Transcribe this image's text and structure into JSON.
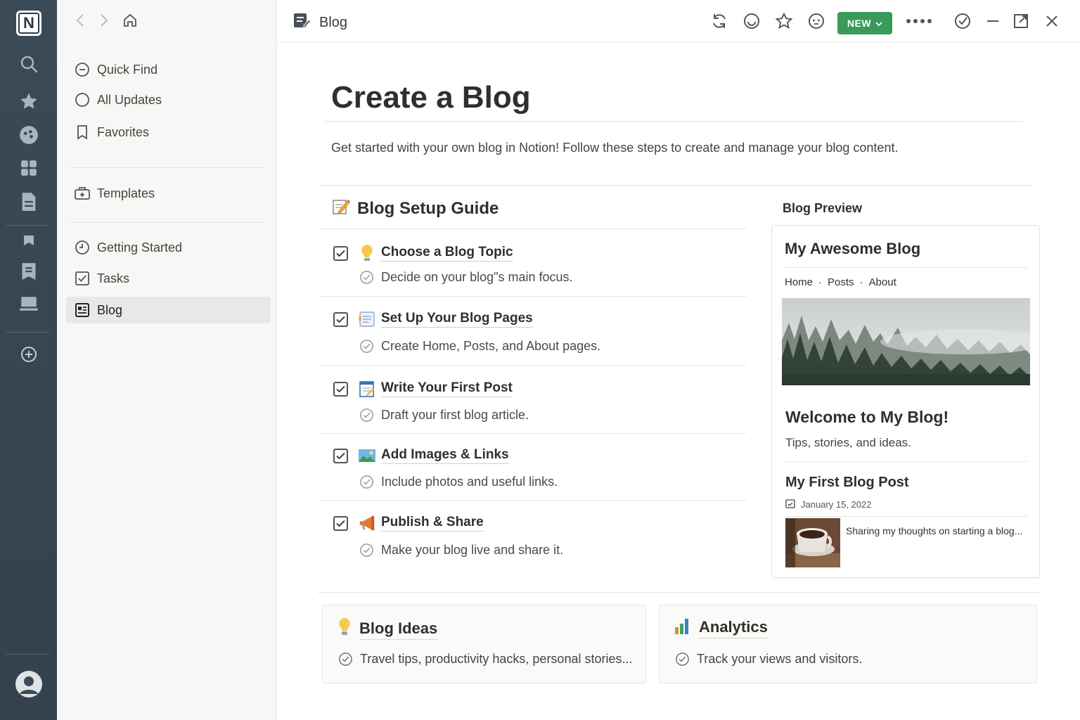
{
  "rail": {
    "icons": [
      "notion-logo-icon",
      "search-icon",
      "star-icon",
      "palette-icon",
      "grid-icon",
      "document-icon",
      "bookmark-icon",
      "reading-list-icon",
      "laptop-icon",
      "add-circle-icon",
      "user-avatar-icon"
    ]
  },
  "sidebar": {
    "items": [
      {
        "label": "Quick Find",
        "icon": "minus-circle-icon"
      },
      {
        "label": "All Updates",
        "icon": "circle-icon"
      },
      {
        "label": "Favorites",
        "icon": "bookmark-outline-icon"
      },
      {
        "label": "Templates",
        "icon": "template-icon"
      },
      {
        "label": "Getting Started",
        "icon": "clock-icon"
      },
      {
        "label": "Tasks",
        "icon": "checkbox-icon"
      },
      {
        "label": "Blog",
        "icon": "blog-icon",
        "active": true
      }
    ]
  },
  "topbar": {
    "title": "Blog",
    "new_label": "NEW"
  },
  "page": {
    "title": "Create a Blog",
    "intro": "Get started with your own blog in Notion! Follow these steps to create and manage your blog content."
  },
  "guide": {
    "heading": "Blog Setup Guide",
    "steps": [
      {
        "title": "Choose a Blog Topic",
        "desc": "Decide on your blog\"s main focus.",
        "emoji": "lightbulb-icon"
      },
      {
        "title": "Set Up Your Blog Pages",
        "desc": "Create Home, Posts, and About pages.",
        "emoji": "memo-pages-icon"
      },
      {
        "title": "Write Your First Post",
        "desc": "Draft your first blog article.",
        "emoji": "notepad-icon"
      },
      {
        "title": "Add Images & Links",
        "desc": "Include photos and useful links.",
        "emoji": "landscape-image-icon"
      },
      {
        "title": "Publish & Share",
        "desc": "Make your blog live and share it.",
        "emoji": "megaphone-icon"
      }
    ]
  },
  "preview": {
    "label": "Blog Preview",
    "blog_title": "My Awesome Blog",
    "nav": [
      "Home",
      "Posts",
      "About"
    ],
    "nav_sep": "·",
    "welcome": "Welcome to My Blog!",
    "tagline": "Tips, stories, and ideas.",
    "post_title": "My First Blog Post",
    "post_date": "January 15, 2022",
    "post_snippet": "Sharing my thoughts on starting a blog..."
  },
  "cards": {
    "ideas": {
      "title": "Blog Ideas",
      "desc": "Travel tips, productivity hacks, personal stories..."
    },
    "analytics": {
      "title": "Analytics",
      "desc": "Track your views and visitors."
    }
  },
  "colors": {
    "accent_green": "#3a9a5a",
    "rail": "#3a4a56",
    "sidebar": "#f7f7f5"
  }
}
